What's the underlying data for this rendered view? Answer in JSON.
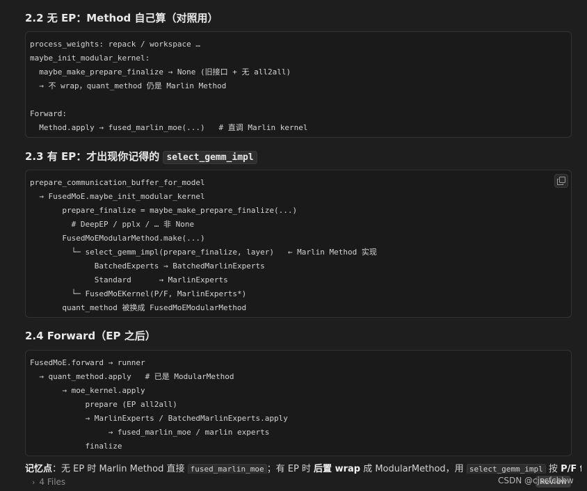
{
  "sections": [
    {
      "title": "2.2 无 EP：Method 自己算（对照用）",
      "code": "process_weights: repack / workspace …\nmaybe_init_modular_kernel:\n  maybe_make_prepare_finalize → None (旧接口 + 无 all2all)\n  → 不 wrap，quant_method 仍是 Marlin Method\n\nForward:\n  Method.apply → fused_marlin_moe(...)   # 直调 Marlin kernel"
    },
    {
      "title_prefix": "2.3 有 EP：才出现你记得的 ",
      "title_code": "select_gemm_impl",
      "code": "prepare_communication_buffer_for_model\n  → FusedMoE.maybe_init_modular_kernel\n       prepare_finalize = maybe_make_prepare_finalize(...)\n         # DeepEP / pplx / … 非 None\n       FusedMoEModularMethod.make(...)\n         └─ select_gemm_impl(prepare_finalize, layer)   ← Marlin Method 实现\n              BatchedExperts → BatchedMarlinExperts\n              Standard      → MarlinExperts\n         └─ FusedMoEKernel(P/F, MarlinExperts*)\n       quant_method 被换成 FusedMoEModularMethod"
    },
    {
      "title": "2.4 Forward（EP 之后）",
      "code": "FusedMoE.forward → runner\n  → quant_method.apply   # 已是 ModularMethod\n       → moe_kernel.apply\n            prepare (EP all2all)\n            → MarlinExperts / BatchedMarlinExperts.apply\n                 → fused_marlin_moe / marlin experts\n            finalize"
    }
  ],
  "note": {
    "label": "记忆点",
    "t1": "：无 EP 时 Marlin Method 直接 ",
    "code1": "fused_marlin_moe",
    "t2": "；有 EP 时 ",
    "bold2": "后置 wrap",
    "t3": " 成 ModularMethod，用 ",
    "code2": "select_gemm_impl",
    "t4": " 按 ",
    "bold3": "P/F format"
  },
  "bottom": {
    "files_label": "4 Files",
    "review_label": "Review",
    "watermark": "CSDN @cjscfcbhw"
  },
  "icons": {
    "copy": "copy-icon",
    "chevron": "chevron-right-icon"
  }
}
